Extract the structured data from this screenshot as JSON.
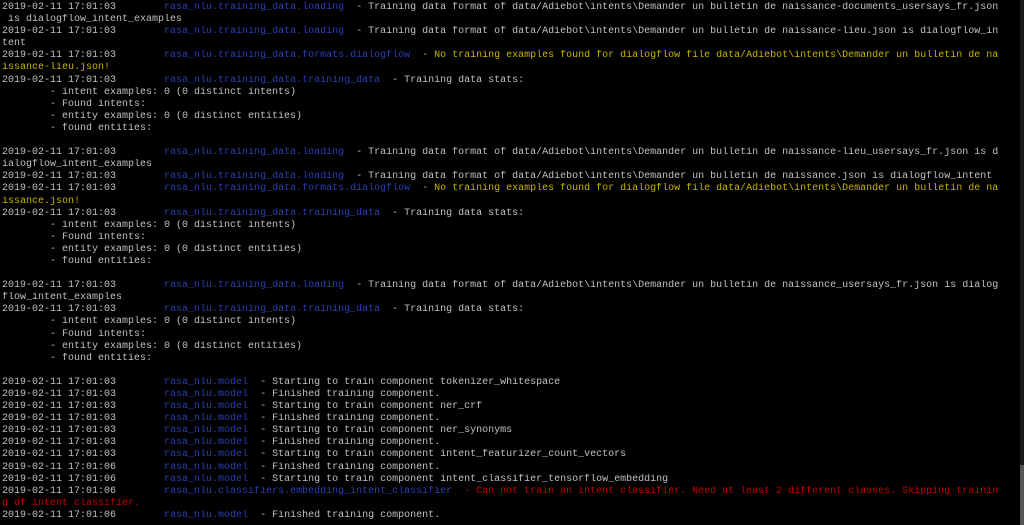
{
  "terminal": {
    "lines": [
      {
        "ts": "2019-02-11 17:01:03",
        "pad": "        ",
        "logger": "rasa_nlu.training_data.loading",
        "sep": "  - ",
        "msg": "Training data format of data/Adiebot\\intents\\Demander un bulletin de naissance-documents_usersays_fr.json",
        "cls": ""
      },
      {
        "ts": "",
        "pad": "",
        "logger": "",
        "sep": "",
        "msg": " is dialogflow_intent_examples",
        "cls": ""
      },
      {
        "ts": "2019-02-11 17:01:03",
        "pad": "        ",
        "logger": "rasa_nlu.training_data.loading",
        "sep": "  - ",
        "msg": "Training data format of data/Adiebot\\intents\\Demander un bulletin de naissance-lieu.json is dialogflow_in",
        "cls": ""
      },
      {
        "ts": "",
        "pad": "",
        "logger": "",
        "sep": "",
        "msg": "tent",
        "cls": ""
      },
      {
        "ts": "2019-02-11 17:01:03",
        "pad": "        ",
        "logger": "rasa_nlu.training_data.formats.dialogflow",
        "sep": "  - ",
        "msg": "No training examples found for dialogflow file data/Adiebot\\intents\\Demander un bulletin de na",
        "cls": "warn"
      },
      {
        "ts": "",
        "pad": "",
        "logger": "",
        "sep": "",
        "msg": "issance-lieu.json!",
        "cls": "warn"
      },
      {
        "ts": "2019-02-11 17:01:03",
        "pad": "        ",
        "logger": "rasa_nlu.training_data.training_data",
        "sep": "  - ",
        "msg": "Training data stats:",
        "cls": ""
      },
      {
        "ts": "",
        "pad": "",
        "logger": "",
        "sep": "",
        "msg": "        - intent examples: 0 (0 distinct intents)",
        "cls": ""
      },
      {
        "ts": "",
        "pad": "",
        "logger": "",
        "sep": "",
        "msg": "        - Found intents:",
        "cls": ""
      },
      {
        "ts": "",
        "pad": "",
        "logger": "",
        "sep": "",
        "msg": "        - entity examples: 0 (0 distinct entities)",
        "cls": ""
      },
      {
        "ts": "",
        "pad": "",
        "logger": "",
        "sep": "",
        "msg": "        - found entities:",
        "cls": ""
      },
      {
        "ts": "",
        "pad": "",
        "logger": "",
        "sep": "",
        "msg": "",
        "cls": ""
      },
      {
        "ts": "2019-02-11 17:01:03",
        "pad": "        ",
        "logger": "rasa_nlu.training_data.loading",
        "sep": "  - ",
        "msg": "Training data format of data/Adiebot\\intents\\Demander un bulletin de naissance-lieu_usersays_fr.json is d",
        "cls": ""
      },
      {
        "ts": "",
        "pad": "",
        "logger": "",
        "sep": "",
        "msg": "ialogflow_intent_examples",
        "cls": ""
      },
      {
        "ts": "2019-02-11 17:01:03",
        "pad": "        ",
        "logger": "rasa_nlu.training_data.loading",
        "sep": "  - ",
        "msg": "Training data format of data/Adiebot\\intents\\Demander un bulletin de naissance.json is dialogflow_intent",
        "cls": ""
      },
      {
        "ts": "2019-02-11 17:01:03",
        "pad": "        ",
        "logger": "rasa_nlu.training_data.formats.dialogflow",
        "sep": "  - ",
        "msg": "No training examples found for dialogflow file data/Adiebot\\intents\\Demander un bulletin de na",
        "cls": "warn"
      },
      {
        "ts": "",
        "pad": "",
        "logger": "",
        "sep": "",
        "msg": "issance.json!",
        "cls": "warn"
      },
      {
        "ts": "2019-02-11 17:01:03",
        "pad": "        ",
        "logger": "rasa_nlu.training_data.training_data",
        "sep": "  - ",
        "msg": "Training data stats:",
        "cls": ""
      },
      {
        "ts": "",
        "pad": "",
        "logger": "",
        "sep": "",
        "msg": "        - intent examples: 0 (0 distinct intents)",
        "cls": ""
      },
      {
        "ts": "",
        "pad": "",
        "logger": "",
        "sep": "",
        "msg": "        - Found intents:",
        "cls": ""
      },
      {
        "ts": "",
        "pad": "",
        "logger": "",
        "sep": "",
        "msg": "        - entity examples: 0 (0 distinct entities)",
        "cls": ""
      },
      {
        "ts": "",
        "pad": "",
        "logger": "",
        "sep": "",
        "msg": "        - found entities:",
        "cls": ""
      },
      {
        "ts": "",
        "pad": "",
        "logger": "",
        "sep": "",
        "msg": "",
        "cls": ""
      },
      {
        "ts": "2019-02-11 17:01:03",
        "pad": "        ",
        "logger": "rasa_nlu.training_data.loading",
        "sep": "  - ",
        "msg": "Training data format of data/Adiebot\\intents\\Demander un bulletin de naissance_usersays_fr.json is dialog",
        "cls": ""
      },
      {
        "ts": "",
        "pad": "",
        "logger": "",
        "sep": "",
        "msg": "flow_intent_examples",
        "cls": ""
      },
      {
        "ts": "2019-02-11 17:01:03",
        "pad": "        ",
        "logger": "rasa_nlu.training_data.training_data",
        "sep": "  - ",
        "msg": "Training data stats:",
        "cls": ""
      },
      {
        "ts": "",
        "pad": "",
        "logger": "",
        "sep": "",
        "msg": "        - intent examples: 0 (0 distinct intents)",
        "cls": ""
      },
      {
        "ts": "",
        "pad": "",
        "logger": "",
        "sep": "",
        "msg": "        - Found intents:",
        "cls": ""
      },
      {
        "ts": "",
        "pad": "",
        "logger": "",
        "sep": "",
        "msg": "        - entity examples: 0 (0 distinct entities)",
        "cls": ""
      },
      {
        "ts": "",
        "pad": "",
        "logger": "",
        "sep": "",
        "msg": "        - found entities:",
        "cls": ""
      },
      {
        "ts": "",
        "pad": "",
        "logger": "",
        "sep": "",
        "msg": "",
        "cls": ""
      },
      {
        "ts": "2019-02-11 17:01:03",
        "pad": "        ",
        "logger": "rasa_nlu.model",
        "sep": "  - ",
        "msg": "Starting to train component tokenizer_whitespace",
        "cls": ""
      },
      {
        "ts": "2019-02-11 17:01:03",
        "pad": "        ",
        "logger": "rasa_nlu.model",
        "sep": "  - ",
        "msg": "Finished training component.",
        "cls": ""
      },
      {
        "ts": "2019-02-11 17:01:03",
        "pad": "        ",
        "logger": "rasa_nlu.model",
        "sep": "  - ",
        "msg": "Starting to train component ner_crf",
        "cls": ""
      },
      {
        "ts": "2019-02-11 17:01:03",
        "pad": "        ",
        "logger": "rasa_nlu.model",
        "sep": "  - ",
        "msg": "Finished training component.",
        "cls": ""
      },
      {
        "ts": "2019-02-11 17:01:03",
        "pad": "        ",
        "logger": "rasa_nlu.model",
        "sep": "  - ",
        "msg": "Starting to train component ner_synonyms",
        "cls": ""
      },
      {
        "ts": "2019-02-11 17:01:03",
        "pad": "        ",
        "logger": "rasa_nlu.model",
        "sep": "  - ",
        "msg": "Finished training component.",
        "cls": ""
      },
      {
        "ts": "2019-02-11 17:01:03",
        "pad": "        ",
        "logger": "rasa_nlu.model",
        "sep": "  - ",
        "msg": "Starting to train component intent_featurizer_count_vectors",
        "cls": ""
      },
      {
        "ts": "2019-02-11 17:01:06",
        "pad": "        ",
        "logger": "rasa_nlu.model",
        "sep": "  - ",
        "msg": "Finished training component.",
        "cls": ""
      },
      {
        "ts": "2019-02-11 17:01:06",
        "pad": "        ",
        "logger": "rasa_nlu.model",
        "sep": "  - ",
        "msg": "Starting to train component intent_classifier_tensorflow_embedding",
        "cls": ""
      },
      {
        "ts": "2019-02-11 17:01:06",
        "pad": "        ",
        "logger": "rasa_nlu.classifiers.embedding_intent_classifier",
        "sep": "  - ",
        "msg": "Can not train an intent classifier. Need at least 2 different classes. Skipping trainin",
        "cls": "err"
      },
      {
        "ts": "",
        "pad": "",
        "logger": "",
        "sep": "",
        "msg": "g of intent classifier.",
        "cls": "err"
      },
      {
        "ts": "2019-02-11 17:01:06",
        "pad": "        ",
        "logger": "rasa_nlu.model",
        "sep": "  - ",
        "msg": "Finished training component.",
        "cls": ""
      }
    ]
  }
}
